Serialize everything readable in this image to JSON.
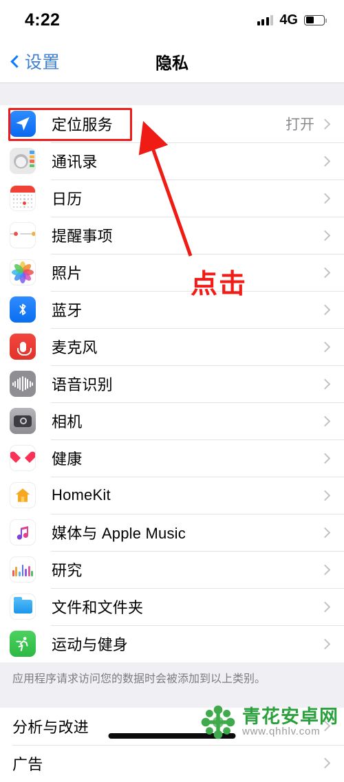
{
  "status_bar": {
    "time": "4:22",
    "network": "4G",
    "battery_level_pct": 47,
    "signal_bars": 4
  },
  "nav": {
    "back_label": "设置",
    "title": "隐私"
  },
  "privacy_list": [
    {
      "label": "定位服务",
      "value": "打开",
      "icon": "location-arrow-icon",
      "highlighted": true
    },
    {
      "label": "通讯录",
      "value": "",
      "icon": "contacts-icon"
    },
    {
      "label": "日历",
      "value": "",
      "icon": "calendar-icon"
    },
    {
      "label": "提醒事项",
      "value": "",
      "icon": "reminders-icon"
    },
    {
      "label": "照片",
      "value": "",
      "icon": "photos-icon"
    },
    {
      "label": "蓝牙",
      "value": "",
      "icon": "bluetooth-icon"
    },
    {
      "label": "麦克风",
      "value": "",
      "icon": "microphone-icon"
    },
    {
      "label": "语音识别",
      "value": "",
      "icon": "speech-waveform-icon"
    },
    {
      "label": "相机",
      "value": "",
      "icon": "camera-icon"
    },
    {
      "label": "健康",
      "value": "",
      "icon": "health-heart-icon"
    },
    {
      "label": "HomeKit",
      "value": "",
      "icon": "homekit-house-icon"
    },
    {
      "label": "媒体与 Apple Music",
      "value": "",
      "icon": "music-note-icon"
    },
    {
      "label": "研究",
      "value": "",
      "icon": "research-bars-icon"
    },
    {
      "label": "文件和文件夹",
      "value": "",
      "icon": "folder-icon"
    },
    {
      "label": "运动与健身",
      "value": "",
      "icon": "fitness-runner-icon"
    }
  ],
  "footer_note": "应用程序请求访问您的数据时会被添加到以上类别。",
  "bottom_list": [
    {
      "label": "分析与改进",
      "value": ""
    },
    {
      "label": "广告",
      "value": ""
    }
  ],
  "annotation": {
    "tap_text": "点击",
    "highlight_color": "#ef1a16",
    "arrow_color": "#ee1c15"
  },
  "watermark": {
    "name": "青花安卓网",
    "url": "www.qhhlv.com",
    "color": "#2aa13c"
  }
}
